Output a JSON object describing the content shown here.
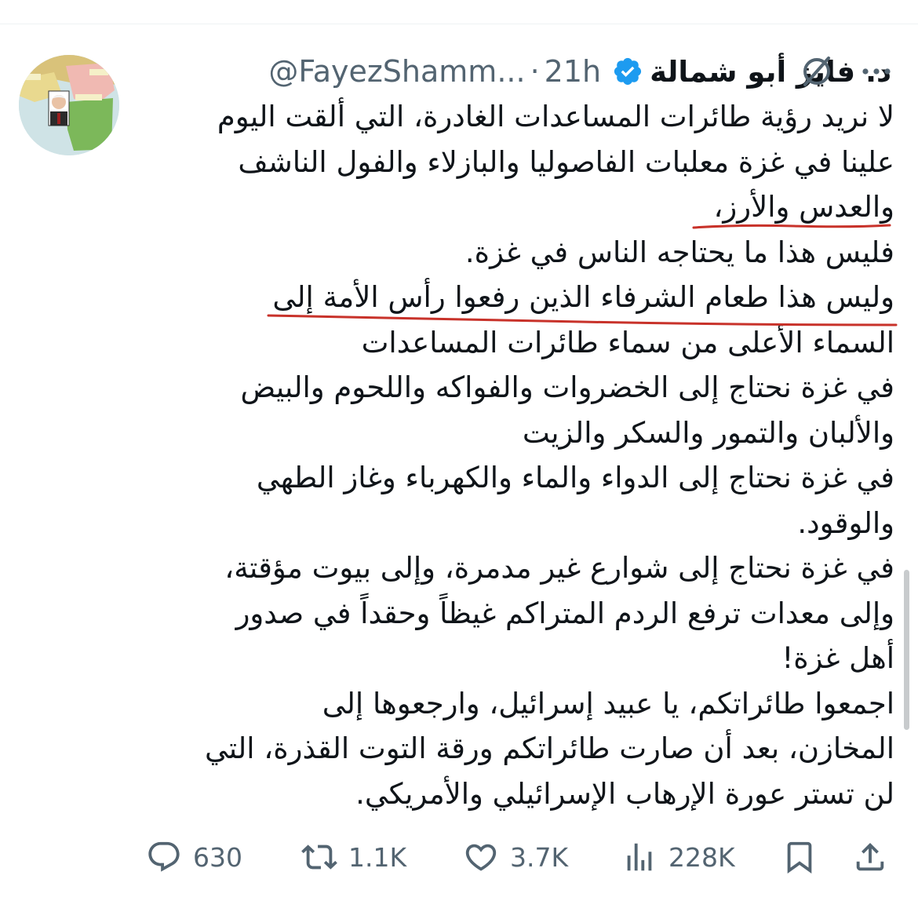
{
  "tweet": {
    "author_name": "د. فايز أبو شمالة",
    "handle": "@FayezShamm...",
    "separator": "·",
    "time": "21h",
    "lines": [
      "لا نريد رؤية طائرات المساعدات الغادرة، التي ألقت اليوم",
      "علينا في غزة معلبات الفاصوليا والبازلاء والفول الناشف",
      "والعدس والأرز،",
      "فليس هذا ما يحتاجه الناس في غزة.",
      "وليس هذا طعام الشرفاء الذين رفعوا رأس الأمة إلى",
      "السماء الأعلى من سماء طائرات المساعدات",
      "في غزة نحتاج إلى الخضروات والفواكه واللحوم والبيض",
      "والألبان والتمور والسكر والزيت",
      "في غزة نحتاج إلى الدواء والماء والكهرباء وغاز الطهي",
      "والوقود.",
      "في غزة نحتاج إلى شوارع غير مدمرة، وإلى بيوت مؤقتة،",
      "وإلى معدات ترفع الردم المتراكم غيظاً وحقداً في صدور",
      "أهل غزة!",
      "اجمعوا طائراتكم، يا عبيد إسرائيل، وارجعوها إلى",
      "المخازن، بعد أن صارت طائراتكم ورقة التوت القذرة، التي",
      "لن تستر عورة الإرهاب الإسرائيلي والأمريكي."
    ]
  },
  "actions": {
    "replies": "630",
    "reposts": "1.1K",
    "likes": "3.7K",
    "views": "228K"
  },
  "icons": {
    "verified": "verified-badge-icon",
    "grok": "grok-icon",
    "more": "more-options-icon",
    "reply": "reply-icon",
    "repost": "repost-icon",
    "like": "like-icon",
    "views": "views-icon",
    "bookmark": "bookmark-icon",
    "share": "share-icon"
  },
  "colors": {
    "verified": "#1d9bf0",
    "text": "#0f1419",
    "secondary": "#536471",
    "underline": "#c8322a"
  }
}
